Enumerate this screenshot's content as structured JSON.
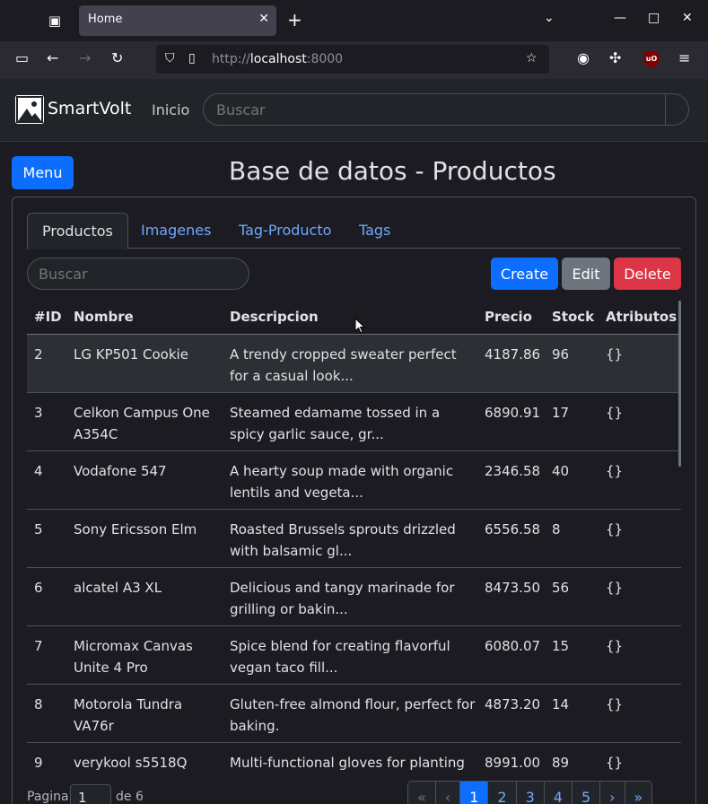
{
  "browser": {
    "tab_title": "Home",
    "url_scheme": "http://",
    "url_host": "localhost",
    "url_port": ":8000"
  },
  "app": {
    "brand": "SmartVolt",
    "nav_link": "Inicio",
    "search_placeholder": "Buscar"
  },
  "page": {
    "title": "Base de datos - Productos",
    "menu_label": "Menu"
  },
  "tabs": [
    "Productos",
    "Imagenes",
    "Tag-Producto",
    "Tags"
  ],
  "toolbar": {
    "search_placeholder": "Buscar",
    "create_label": "Create",
    "edit_label": "Edit",
    "delete_label": "Delete"
  },
  "table": {
    "headers": [
      "#ID",
      "Nombre",
      "Descripcion",
      "Precio",
      "Stock",
      "Atributos"
    ],
    "rows": [
      {
        "id": "2",
        "name": "LG KP501 Cookie",
        "desc": "A trendy cropped sweater perfect for a casual look...",
        "price": "4187.86",
        "stock": "96",
        "attr": "{}"
      },
      {
        "id": "3",
        "name": "Celkon Campus One A354C",
        "desc": "Steamed edamame tossed in a spicy garlic sauce, gr...",
        "price": "6890.91",
        "stock": "17",
        "attr": "{}"
      },
      {
        "id": "4",
        "name": "Vodafone 547",
        "desc": "A hearty soup made with organic lentils and vegeta...",
        "price": "2346.58",
        "stock": "40",
        "attr": "{}"
      },
      {
        "id": "5",
        "name": "Sony Ericsson Elm",
        "desc": "Roasted Brussels sprouts drizzled with balsamic gl...",
        "price": "6556.58",
        "stock": "8",
        "attr": "{}"
      },
      {
        "id": "6",
        "name": "alcatel A3 XL",
        "desc": "Delicious and tangy marinade for grilling or bakin...",
        "price": "8473.50",
        "stock": "56",
        "attr": "{}"
      },
      {
        "id": "7",
        "name": "Micromax Canvas Unite 4 Pro",
        "desc": "Spice blend for creating flavorful vegan taco fill...",
        "price": "6080.07",
        "stock": "15",
        "attr": "{}"
      },
      {
        "id": "8",
        "name": "Motorola Tundra VA76r",
        "desc": "Gluten-free almond flour, perfect for baking.",
        "price": "4873.20",
        "stock": "14",
        "attr": "{}"
      },
      {
        "id": "9",
        "name": "verykool s5518Q",
        "desc": "Multi-functional gloves for planting",
        "price": "8991.00",
        "stock": "89",
        "attr": "{}"
      }
    ]
  },
  "pagination": {
    "pagina_label": "Pagina",
    "current_page": "1",
    "of_label": "de 6",
    "items": [
      "«",
      "‹",
      "1",
      "2",
      "3",
      "4",
      "5",
      "›",
      "»"
    ]
  }
}
